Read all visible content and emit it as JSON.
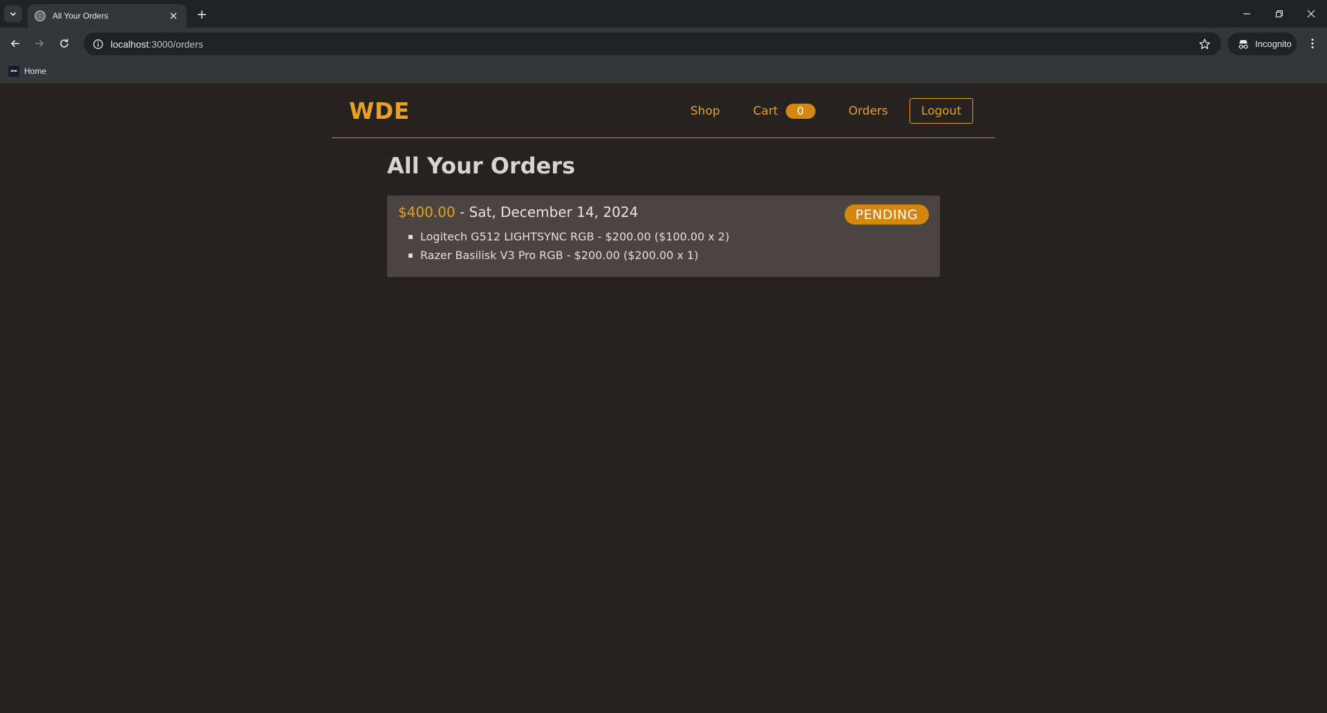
{
  "browser": {
    "tab_title": "All Your Orders",
    "url_host": "localhost",
    "url_path": ":3000/orders",
    "incognito_label": "Incognito",
    "bookmark_label": "Home"
  },
  "header": {
    "logo": "WDE",
    "nav": {
      "shop": "Shop",
      "cart": "Cart",
      "cart_count": "0",
      "orders": "Orders",
      "logout": "Logout"
    }
  },
  "page_title": "All Your Orders",
  "orders": [
    {
      "total": "$400.00",
      "date_text": " - Sat, December 14, 2024",
      "status": "PENDING",
      "items": [
        "Logitech G512 LIGHTSYNC RGB - $200.00 ($100.00 x 2)",
        "Razer Basilisk V3 Pro RGB - $200.00 ($200.00 x 1)"
      ]
    }
  ],
  "colors": {
    "accent": "#e59f2a",
    "badge": "#d4860f",
    "background": "#25221f",
    "card": "#4a4541"
  }
}
